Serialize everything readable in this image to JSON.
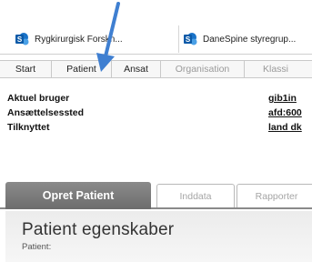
{
  "browser_tabs": [
    {
      "label": "Rygkirurgisk Forskn...",
      "icon": "sharepoint-icon"
    },
    {
      "label": "DaneSpine styregrup...",
      "icon": "sharepoint-icon"
    }
  ],
  "menu": [
    {
      "label": "Start",
      "active": true
    },
    {
      "label": "Patient",
      "active": true
    },
    {
      "label": "Ansat",
      "active": true
    },
    {
      "label": "Organisation",
      "active": false
    },
    {
      "label": "Klassi",
      "active": false
    }
  ],
  "user_info": [
    {
      "label": "Aktuel bruger",
      "value": "gib1in"
    },
    {
      "label": "Ansættelsessted",
      "value": "afd:600"
    },
    {
      "label": "Tilknyttet",
      "value": "land dk"
    }
  ],
  "page_tabs": {
    "active": "Opret Patient",
    "others": [
      "Inddata",
      "Rapporter"
    ]
  },
  "panel": {
    "title": "Patient egenskaber",
    "subtitle": "Patient:"
  },
  "colors": {
    "accent_arrow": "#3f7fd1",
    "active_tab_bg": "#7a7a7a",
    "sharepoint_blue": "#1a73c8"
  }
}
